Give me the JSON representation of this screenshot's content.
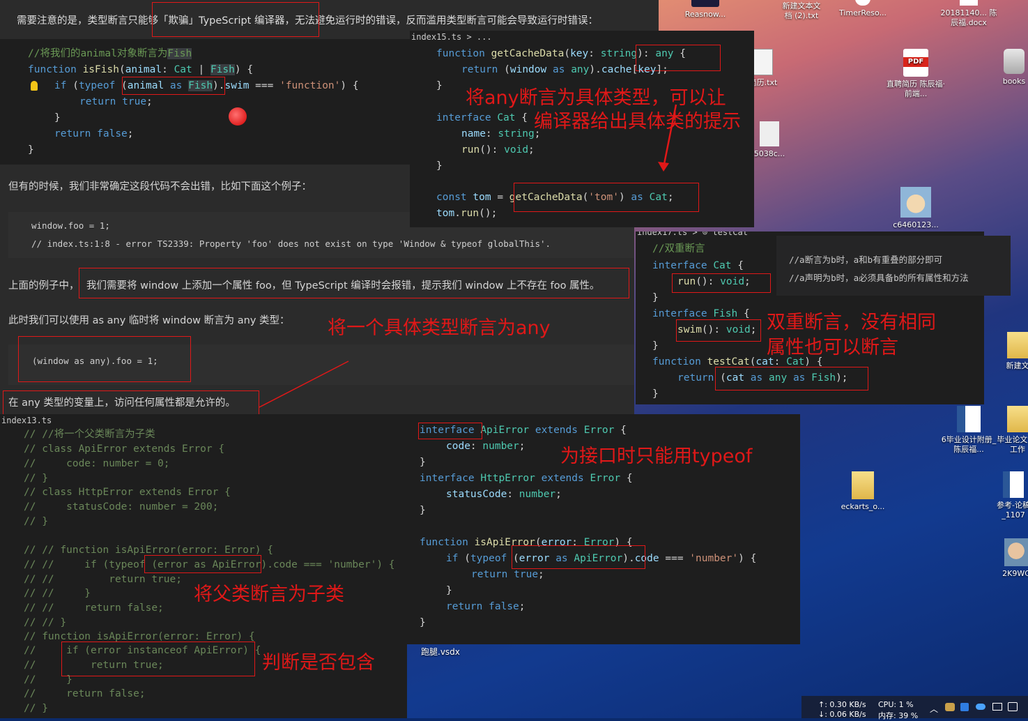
{
  "top_note": "需要注意的是，类型断言只能够「欺骗」TypeScript 编译器，无法避免运行时的错误，反而滥用类型断言可能会导致运行时错误：",
  "doc": {
    "p1": "但有的时候，我们非常确定这段代码不会出错，比如下面这个例子：",
    "code1_line1": "window.foo = 1;",
    "code1_line2": "// index.ts:1:8 - error TS2339: Property 'foo' does not exist on type 'Window & typeof globalThis'.",
    "p2_prefix": "上面的例子中，",
    "p2_main": "我们需要将 window 上添加一个属性 foo，但 TypeScript 编译时会报错，提示我们 window 上不存在 foo 属性。",
    "p3": "此时我们可以使用 as any 临时将 window 断言为 any 类型：",
    "code2": "(window as any).foo = 1;",
    "p4": "在 any 类型的变量上，访问任何属性都是允许的。"
  },
  "annotations": {
    "a1_line1": "将any断言为具体类型，可以让",
    "a1_line2": "编译器给出具体类的提示",
    "a2": "将一个具体类型断言为any",
    "a3_line1": "双重断言，没有相同",
    "a3_line2": "属性也可以断言",
    "a4": "为接口时只能用typeof",
    "a5": "将父类断言为子类",
    "a6": "判断是否包含"
  },
  "editor_tabs": {
    "tab_top": "index15.ts > ...",
    "tab_right": "index17.ts > ⊙ testCat",
    "tab_bottom": "index13.ts",
    "file_vsdx": "跑腿.vsdx"
  },
  "double_notes": {
    "n1": "//a断言为b时，a和b有重叠的部分即可",
    "n2": "//a声明为b时，a必须具备b的所有属性和方法"
  },
  "desktop_icons": [
    {
      "label": "Reasnow..."
    },
    {
      "label": "新建文本文档 (2).txt"
    },
    {
      "label": "TimerReso..."
    },
    {
      "label": "20181140... 陈辰福.docx"
    },
    {
      "label": "简历.txt"
    },
    {
      "label": "直聘简历 陈辰福·前端..."
    },
    {
      "label": "books"
    },
    {
      "label": "5038c..."
    },
    {
      "label": "c6460123..."
    },
    {
      "label": "新建文"
    },
    {
      "label": "6毕业设计附册_陈辰福..."
    },
    {
      "label": "毕业论文计) 工作"
    },
    {
      "label": "eckarts_o..."
    },
    {
      "label": "参考-论稿_1107"
    },
    {
      "label": "2K9WC"
    }
  ],
  "taskbar": {
    "net_up": "↑: 0.30 KB/s",
    "net_down": "↓: 0.06 KB/s",
    "cpu": "CPU: 1 %",
    "mem": "内存: 39 %"
  },
  "colors": {
    "annotation": "#e01818",
    "editor_bg": "#1e1e1e",
    "doc_bg": "#2b2b2b"
  }
}
